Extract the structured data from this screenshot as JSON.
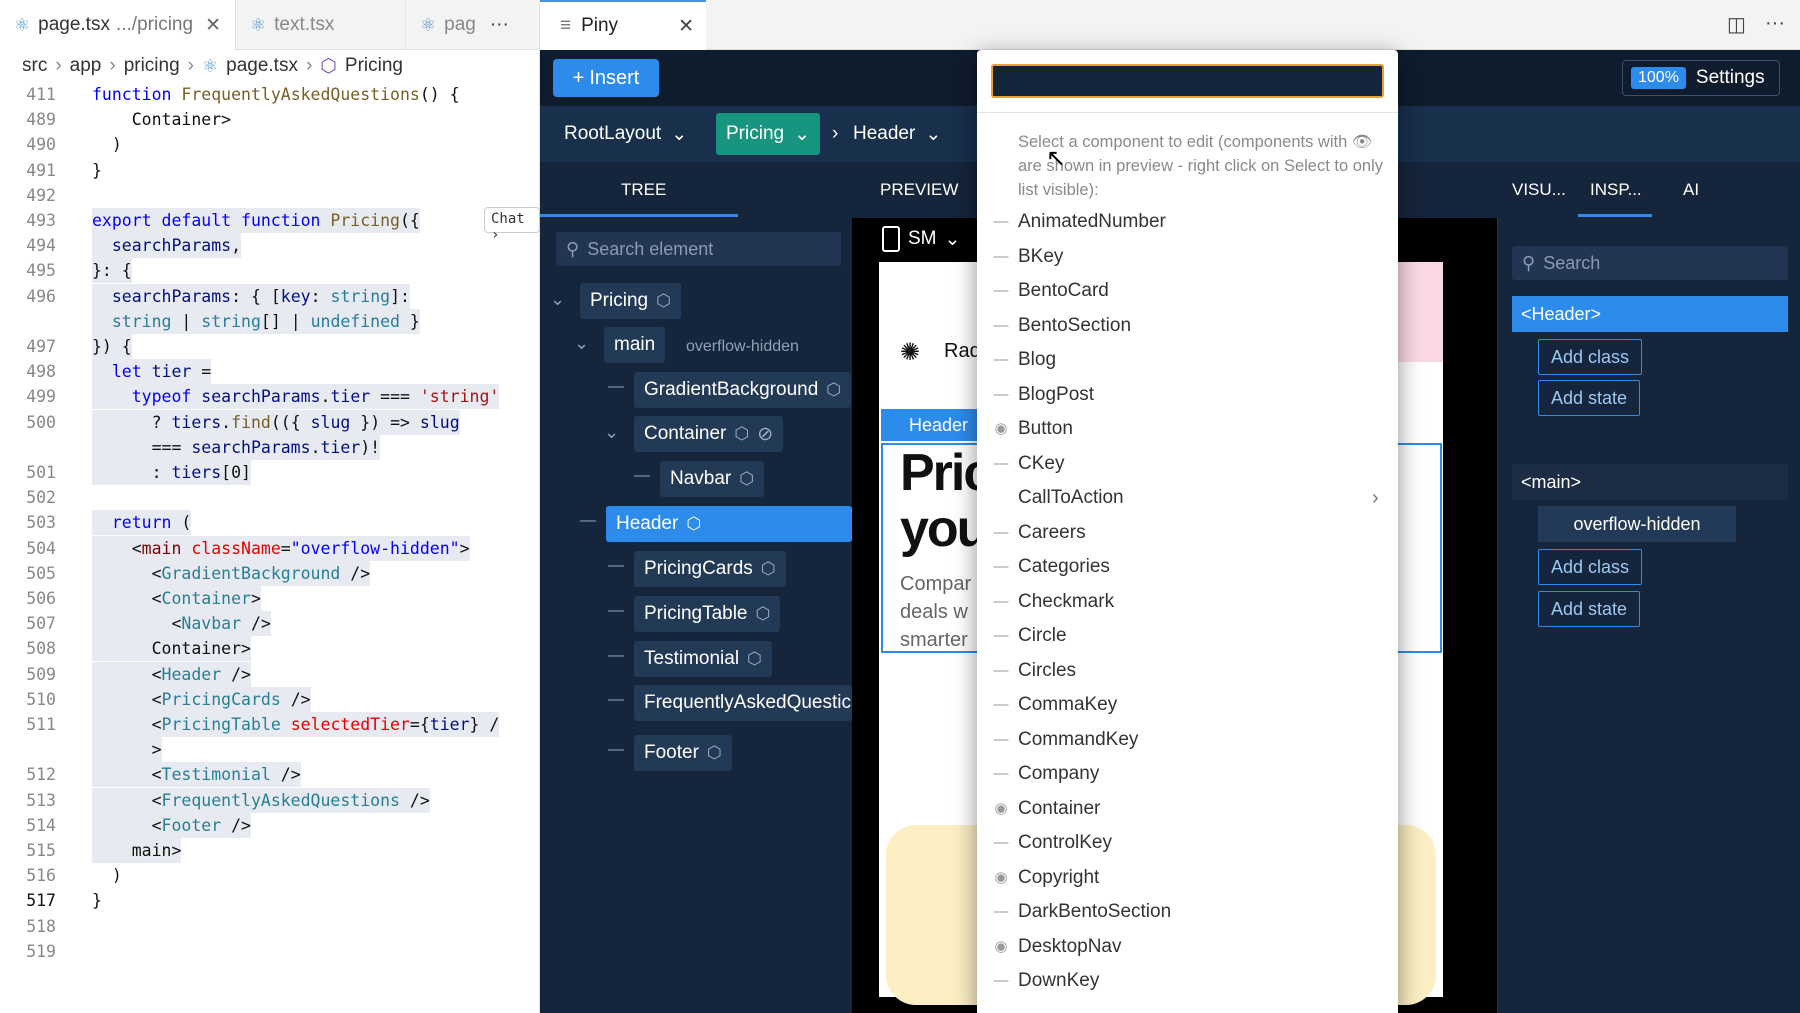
{
  "editor": {
    "tabs": [
      {
        "name": "page.tsx",
        "sub": ".../pricing"
      },
      {
        "name": "text.tsx",
        "sub": ""
      },
      {
        "name": "pag",
        "sub": ""
      }
    ],
    "tab_more": "···",
    "breadcrumb": [
      "src",
      "app",
      "pricing",
      "page.tsx",
      "Pricing"
    ],
    "chat_label": "Chat",
    "lines": [
      {
        "n": "411",
        "html": "<span class='k'>function</span> <span class='f'>FrequentlyAskedQuestions</span>() {"
      },
      {
        "n": "489",
        "html": "    </<span class='t'>Container</span>>"
      },
      {
        "n": "490",
        "html": "  )"
      },
      {
        "n": "491",
        "html": "}"
      },
      {
        "n": "492",
        "html": ""
      },
      {
        "n": "493",
        "html": "<span class='k'>export default function</span> <span class='f'>Pricing</span>({"
      },
      {
        "n": "494",
        "html": "  <span class='v'>searchParams</span>,"
      },
      {
        "n": "495",
        "html": "}: {"
      },
      {
        "n": "496",
        "html": "  <span class='v'>searchParams</span>: { [<span class='v'>key</span>: <span class='t'>string</span>]:"
      },
      {
        "n": "",
        "html": "  <span class='t'>string</span> | <span class='t'>string</span>[] | <span class='t'>undefined</span> }"
      },
      {
        "n": "497",
        "html": "}) {"
      },
      {
        "n": "498",
        "html": "  <span class='k'>let</span> <span class='v'>tier</span> ="
      },
      {
        "n": "499",
        "html": "    <span class='k'>typeof</span> <span class='v'>searchParams</span>.<span class='v'>tier</span> === <span class='s'>'string'</span>"
      },
      {
        "n": "500",
        "html": "      ? <span class='v'>tiers</span>.<span class='f'>find</span>(({ <span class='v'>slug</span> }) => <span class='v'>slug</span>"
      },
      {
        "n": "",
        "html": "      === <span class='v'>searchParams</span>.<span class='v'>tier</span>)!"
      },
      {
        "n": "501",
        "html": "      : <span class='v'>tiers</span>[0]"
      },
      {
        "n": "502",
        "html": ""
      },
      {
        "n": "503",
        "html": "  <span class='k'>return</span> ("
      },
      {
        "n": "504",
        "html": "    <<span class='tag'>main</span> <span class='a'>className</span>=<span class='k'>\"overflow-hidden\"</span>>"
      },
      {
        "n": "505",
        "html": "      <<span class='t'>GradientBackground</span> />"
      },
      {
        "n": "506",
        "html": "      <<span class='t'>Container</span>>"
      },
      {
        "n": "507",
        "html": "        <<span class='t'>Navbar</span> />"
      },
      {
        "n": "508",
        "html": "      </<span class='t'>Container</span>>"
      },
      {
        "n": "509",
        "html": "      <<span class='t'>Header</span> />"
      },
      {
        "n": "510",
        "html": "      <<span class='t'>PricingCards</span> />"
      },
      {
        "n": "511",
        "html": "      <<span class='t'>PricingTable</span> <span class='a'>selectedTier</span>={<span class='v'>tier</span>} /"
      },
      {
        "n": "",
        "html": "      >"
      },
      {
        "n": "512",
        "html": "      <<span class='t'>Testimonial</span> />"
      },
      {
        "n": "513",
        "html": "      <<span class='t'>FrequentlyAskedQuestions</span> />"
      },
      {
        "n": "514",
        "html": "      <<span class='t'>Footer</span> />"
      },
      {
        "n": "515",
        "html": "    </<span class='tag'>main</span>>"
      },
      {
        "n": "516",
        "html": "  )"
      },
      {
        "n": "517",
        "html": "}"
      },
      {
        "n": "518",
        "html": ""
      },
      {
        "n": "519",
        "html": ""
      }
    ]
  },
  "piny": {
    "tab_title": "Piny",
    "insert_label": "Insert",
    "zoom": "100%",
    "settings_label": "Settings",
    "crumbs": [
      "RootLayout",
      "Pricing",
      "Header"
    ],
    "panel_tabs": {
      "tree": "TREE",
      "preview": "PREVIEW",
      "visual": "VISU...",
      "inspect": "INSP...",
      "ai": "AI"
    },
    "tree": {
      "search_placeholder": "Search element",
      "nodes": [
        {
          "label": "Pricing",
          "note": ""
        },
        {
          "label": "main",
          "note": "overflow-hidden"
        },
        {
          "label": "GradientBackground",
          "note": ""
        },
        {
          "label": "Container",
          "note": ""
        },
        {
          "label": "Navbar",
          "note": ""
        },
        {
          "label": "Header",
          "note": ""
        },
        {
          "label": "PricingCards",
          "note": ""
        },
        {
          "label": "PricingTable",
          "note": ""
        },
        {
          "label": "Testimonial",
          "note": ""
        },
        {
          "label": "FrequentlyAskedQuestic",
          "note": ""
        },
        {
          "label": "Footer",
          "note": ""
        }
      ]
    },
    "preview": {
      "device": "SM",
      "header_label": "Header",
      "brand": "Rad",
      "big_text": [
        "Pric",
        "you"
      ],
      "small_text": [
        "Compar",
        "deals w",
        "smarter"
      ]
    },
    "inspector": {
      "search_placeholder": "Search",
      "header_tag": "<Header>",
      "main_tag": "<main>",
      "main_class": "overflow-hidden",
      "add_class": "Add class",
      "add_state": "Add state"
    }
  },
  "dropdown": {
    "hint": "Select a component to edit (components with 👁 are shown in preview - right click on Select to only list visible):",
    "items": [
      {
        "label": "AnimatedNumber",
        "mark": "dash"
      },
      {
        "label": "BKey",
        "mark": "dash"
      },
      {
        "label": "BentoCard",
        "mark": "dash"
      },
      {
        "label": "BentoSection",
        "mark": "dash"
      },
      {
        "label": "Blog",
        "mark": "dash"
      },
      {
        "label": "BlogPost",
        "mark": "dash"
      },
      {
        "label": "Button",
        "mark": "eye"
      },
      {
        "label": "CKey",
        "mark": "dash"
      },
      {
        "label": "CallToAction",
        "mark": "none"
      },
      {
        "label": "Careers",
        "mark": "dash"
      },
      {
        "label": "Categories",
        "mark": "dash"
      },
      {
        "label": "Checkmark",
        "mark": "dash"
      },
      {
        "label": "Circle",
        "mark": "dash"
      },
      {
        "label": "Circles",
        "mark": "dash"
      },
      {
        "label": "CommaKey",
        "mark": "dash"
      },
      {
        "label": "CommandKey",
        "mark": "dash"
      },
      {
        "label": "Company",
        "mark": "dash"
      },
      {
        "label": "Container",
        "mark": "eye"
      },
      {
        "label": "ControlKey",
        "mark": "dash"
      },
      {
        "label": "Copyright",
        "mark": "eye"
      },
      {
        "label": "DarkBentoSection",
        "mark": "dash"
      },
      {
        "label": "DesktopNav",
        "mark": "eye"
      },
      {
        "label": "DownKey",
        "mark": "dash"
      }
    ]
  }
}
